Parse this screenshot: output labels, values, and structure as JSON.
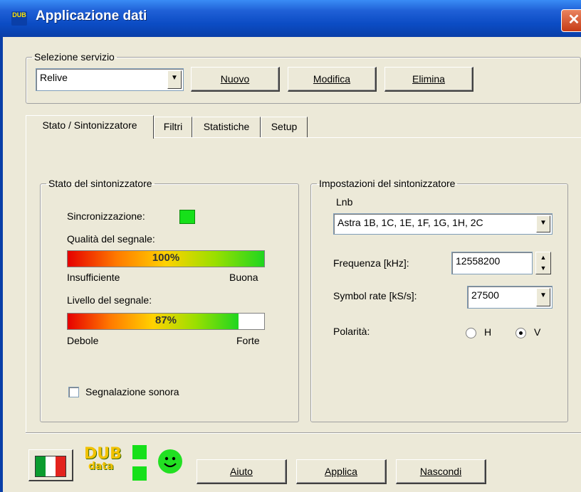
{
  "window": {
    "title": "Applicazione dati",
    "close_label": "✕",
    "app_icon_text": "DUB"
  },
  "service": {
    "legend": "Selezione servizio",
    "selected": "Relive",
    "buttons": {
      "new": "Nuovo",
      "edit": "Modifica",
      "delete": "Elimina"
    }
  },
  "tabs": [
    "Stato / Sintonizzatore",
    "Filtri",
    "Statistiche",
    "Setup"
  ],
  "tuner_status": {
    "legend": "Stato del sintonizzatore",
    "sync_label": "Sincronizzazione:",
    "sync_color": "#16e01a",
    "quality": {
      "label": "Qualità del segnale:",
      "value": 100,
      "value_text": "100%",
      "min_label": "Insufficiente",
      "max_label": "Buona"
    },
    "level": {
      "label": "Livello del segnale:",
      "value": 87,
      "value_text": "87%",
      "min_label": "Debole",
      "max_label": "Forte"
    },
    "sound_label": "Segnalazione sonora",
    "sound_checked": false
  },
  "tuner_settings": {
    "legend": "Impostazioni del sintonizzatore",
    "lnb_label": "Lnb",
    "lnb_value": "Astra 1B, 1C, 1E, 1F, 1G, 1H, 2C",
    "freq_label": "Frequenza [kHz]:",
    "freq_value": "12558200",
    "symbol_label": "Symbol rate [kS/s]:",
    "symbol_value": "27500",
    "polarity_label": "Polarità:",
    "pol_h": "H",
    "pol_v": "V",
    "pol_selected": "V"
  },
  "footer": {
    "logo_top": "DUB",
    "logo_bottom": "data",
    "buttons": {
      "help": "Aiuto",
      "apply": "Applica",
      "hide": "Nascondi"
    }
  },
  "colors": {
    "title_bar": "#0b4cc4",
    "led": "#16e01a",
    "smiley": "#22e022"
  }
}
